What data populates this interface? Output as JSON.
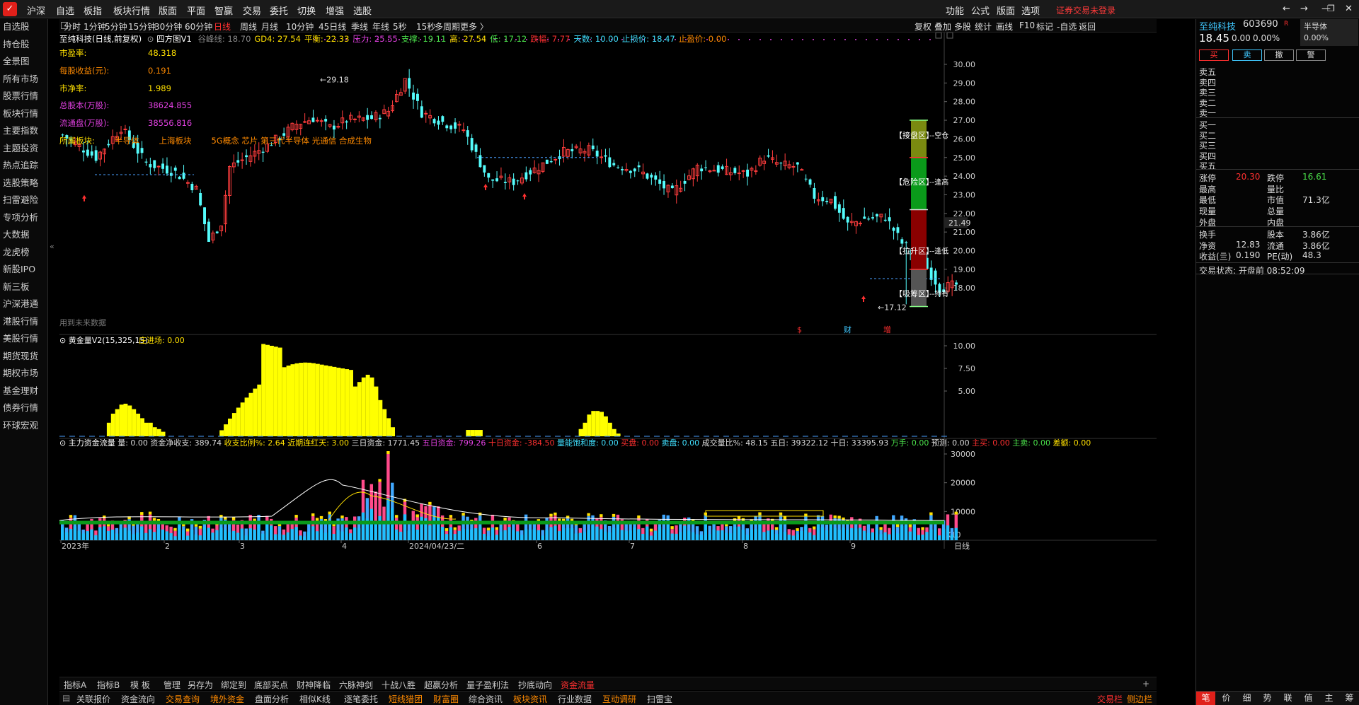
{
  "menu": {
    "items": [
      "沪深",
      "自选",
      "板指",
      "板块行情",
      "版面",
      "平面",
      "智赢",
      "交易",
      "委托",
      "切换",
      "增强",
      "选股"
    ],
    "warning": "证券交易未登录",
    "right": [
      "功能",
      "公式",
      "版面",
      "选项"
    ]
  },
  "sidebar": [
    "自选股",
    "持仓股",
    "全景图",
    "所有市场",
    "股票行情",
    "板块行情",
    "主要指数",
    "主题投资",
    "热点追踪",
    "选股策略",
    "扫雷避险",
    "专项分析",
    "大数据",
    "龙虎榜",
    "新股IPO",
    "新三板",
    "沪深港通",
    "港股行情",
    "美股行情",
    "期货现货",
    "期权市场",
    "基金理财",
    "债券行情",
    "环球宏观"
  ],
  "timeframes": {
    "items": [
      "分时",
      "1分钟",
      "5分钟",
      "15分钟",
      "30分钟",
      "60分钟",
      "日线",
      "周线",
      "月线",
      "10分钟",
      "45日线",
      "季线",
      "年线",
      "5秒",
      "15秒",
      "多周期",
      "更多 〉"
    ],
    "active": "日线",
    "right": [
      "复权",
      "叠加",
      "多股",
      "统计",
      "画线",
      "F10",
      "标记",
      "-自选",
      "返回"
    ]
  },
  "stock": {
    "name": "至纯科技",
    "code": "603690",
    "suffix": "R",
    "price": "18.45",
    "change": "0.00",
    "pct": "0.00%",
    "sector": "半导体",
    "sector_pct": "0.00%"
  },
  "info": {
    "title": "至纯科技(日线,前复权)",
    "indicator": "四方图V1",
    "fields": [
      {
        "k": "谷峰线:",
        "v": "18.70",
        "c": "#888"
      },
      {
        "k": "GD4:",
        "v": "27.54",
        "c": "#ffe000"
      },
      {
        "k": "平衡:",
        "v": "22.33",
        "c": "#ffe000"
      },
      {
        "k": "压力:",
        "v": "25.55",
        "c": "#e040e0"
      },
      {
        "k": "支撑:",
        "v": "19.11",
        "c": "#4ae04a"
      },
      {
        "k": "高:",
        "v": "27.54",
        "c": "#ffe000"
      },
      {
        "k": "低:",
        "v": "17.12",
        "c": "#4ae04a"
      },
      {
        "k": "跌幅:",
        "v": "7.77",
        "c": "#ff3030"
      },
      {
        "k": "天数:",
        "v": "10.00",
        "c": "#40e0ff"
      },
      {
        "k": "止损价:",
        "v": "18.47",
        "c": "#40e0ff"
      },
      {
        "k": "止盈价:",
        "v": "0.00",
        "c": "#ff8a00"
      }
    ]
  },
  "fund": [
    {
      "k": "市盈率:",
      "v": "48.318",
      "kc": "#ffe000",
      "vc": "#ffe000"
    },
    {
      "k": "每股收益(元):",
      "v": "0.191",
      "kc": "#ff8a00",
      "vc": "#ff8a00"
    },
    {
      "k": "市净率:",
      "v": "1.989",
      "kc": "#ffe000",
      "vc": "#ffe000"
    },
    {
      "k": "总股本(万股):",
      "v": "38624.855",
      "kc": "#e040e0",
      "vc": "#e040e0"
    },
    {
      "k": "流通盘(万股):",
      "v": "38556.816",
      "kc": "#e040e0",
      "vc": "#e040e0"
    }
  ],
  "sectors": {
    "label": "所属板块:",
    "items": [
      "半导体",
      "上海板块",
      "5G概念 芯片 第三代半导体 光通信 合成生物"
    ]
  },
  "future_note": "用到未来数据",
  "zones": [
    "【接盘区】",
    "【危险区】",
    "【拉升区】",
    "【吸筹区】"
  ],
  "zone_right": [
    "--空仓",
    "--逢高",
    "--逢低",
    "--持有"
  ],
  "price_axis": [
    "30.00",
    "29.00",
    "28.00",
    "27.00",
    "26.00",
    "25.00",
    "24.00",
    "23.00",
    "22.00",
    "21.00",
    "20.00",
    "19.00",
    "18.00"
  ],
  "price_marker": "21.49",
  "high_label": "29.18",
  "low_label": "17.12",
  "bottom_marks": [
    "$",
    "财",
    "增"
  ],
  "ind2": {
    "title": "黄金量V2(15,325,15)",
    "field": "庄进场: 0.00",
    "axis": [
      "10.00",
      "7.50",
      "5.00"
    ]
  },
  "ind3": {
    "title": "主力资金流量",
    "fields": [
      {
        "t": "量: 0.00",
        "c": "#ddd"
      },
      {
        "t": "资金净收支: 389.74",
        "c": "#ddd"
      },
      {
        "t": "收支比例%: 2.64",
        "c": "#ffe000"
      },
      {
        "t": "近期连红天: 3.00",
        "c": "#ffe000"
      },
      {
        "t": "三日资金: 1771.45",
        "c": "#ddd"
      },
      {
        "t": "五日资金: 799.26",
        "c": "#e040e0"
      },
      {
        "t": "十日资金: -384.50",
        "c": "#ff3030"
      },
      {
        "t": "量能饱和度: 0.00",
        "c": "#40e0ff"
      },
      {
        "t": "买盘: 0.00",
        "c": "#ff3030"
      },
      {
        "t": "卖盘: 0.00",
        "c": "#40e0ff"
      },
      {
        "t": "成交量比%: 48.15",
        "c": "#ddd"
      },
      {
        "t": "五日: 39322.12",
        "c": "#ddd"
      },
      {
        "t": "十日: 33395.93",
        "c": "#ddd"
      },
      {
        "t": "万手: 0.00",
        "c": "#4ae04a"
      },
      {
        "t": "预测: 0.00",
        "c": "#ddd"
      },
      {
        "t": "主买: 0.00",
        "c": "#ff3030"
      },
      {
        "t": "主卖: 0.00",
        "c": "#4ae04a"
      },
      {
        "t": "差额: 0.00",
        "c": "#ffe000"
      }
    ],
    "axis": [
      "30000",
      "20000",
      "10000"
    ],
    "unit": "X10"
  },
  "date_axis": [
    "2023年",
    "2",
    "3",
    "4",
    "2024/04/23/二",
    "6",
    "7",
    "8",
    "9"
  ],
  "date_mode": "日线",
  "tabs1": [
    "指标A",
    "指标B",
    "模 板",
    "管理",
    "另存为",
    "绑定到",
    "底部买点",
    "财神降临",
    "六脉神剑",
    "十战八胜",
    "超赢分析",
    "量子盈利法",
    "抄底动向",
    "资金流量"
  ],
  "tabs1_active": "资金流量",
  "tabs2": [
    "关联报价",
    "资金流向",
    "交易查询",
    "境外资金",
    "盘面分析",
    "相似K线",
    "逐笔委托",
    "短线猎团",
    "财富圈",
    "综合资讯",
    "板块资讯",
    "行业数据",
    "互动调研",
    "扫雷宝"
  ],
  "tabs2_right": [
    "交易栏",
    "侧边栏"
  ],
  "rp_actions": [
    "买",
    "卖",
    "撤",
    "警"
  ],
  "asks": [
    "卖五",
    "卖四",
    "卖三",
    "卖二",
    "卖一"
  ],
  "bids": [
    "买一",
    "买二",
    "买三",
    "买四",
    "买五"
  ],
  "stats": [
    [
      "涨停",
      "20.30",
      "跌停",
      "16.61"
    ],
    [
      "最高",
      "",
      "量比",
      ""
    ],
    [
      "最低",
      "",
      "市值",
      "71.3亿"
    ],
    [
      "现量",
      "",
      "总量",
      ""
    ],
    [
      "外盘",
      "",
      "内盘",
      ""
    ]
  ],
  "stats2": [
    [
      "换手",
      "",
      "股本",
      "3.86亿"
    ],
    [
      "净资",
      "12.83",
      "流通",
      "3.86亿"
    ],
    [
      "收益(亖)",
      "0.190",
      "PE(动)",
      "48.3"
    ]
  ],
  "trade_status": "交易状态: 开盘前 08:52:09",
  "rp_bottom_tabs": [
    "笔",
    "价",
    "细",
    "势",
    "联",
    "值",
    "主",
    "筹"
  ],
  "colors": {
    "up": "#ff3d3d",
    "down": "#54fcfc",
    "accent": "#e0201a"
  }
}
